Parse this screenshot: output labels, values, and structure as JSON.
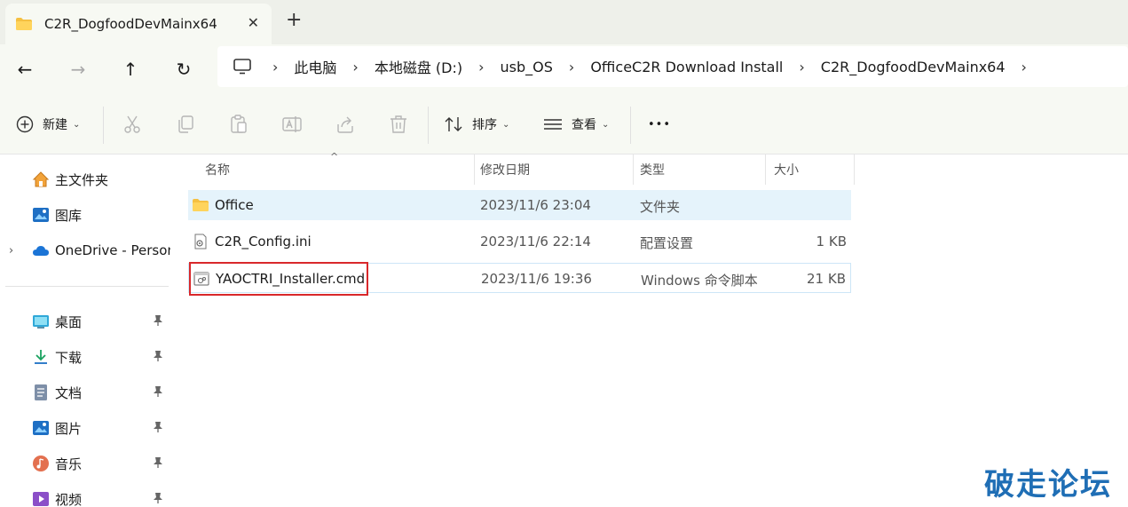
{
  "tab": {
    "title": "C2R_DogfoodDevMainx64",
    "close": "✕",
    "add": "+"
  },
  "nav": {
    "back": "←",
    "forward": "→",
    "up": "↑",
    "refresh": "↻"
  },
  "breadcrumb": [
    "此电脑",
    "本地磁盘 (D:)",
    "usb_OS",
    "OfficeC2R Download Install",
    "C2R_DogfoodDevMainx64"
  ],
  "breadcrumb_sep": "›",
  "toolbar": {
    "new_label": "新建",
    "sort_label": "排序",
    "view_label": "查看",
    "more_label": "•••",
    "caret": "⌄"
  },
  "sidebar": {
    "items": [
      {
        "label": "主文件夹",
        "icon": "home-icon"
      },
      {
        "label": "图库",
        "icon": "gallery-icon"
      },
      {
        "label": "OneDrive - Personal",
        "icon": "cloud-icon",
        "expand": "›"
      },
      {
        "label": "桌面",
        "icon": "desktop-icon",
        "pin": "📌"
      },
      {
        "label": "下载",
        "icon": "download-icon",
        "pin": "📌"
      },
      {
        "label": "文档",
        "icon": "document-icon",
        "pin": "📌"
      },
      {
        "label": "图片",
        "icon": "picture-icon",
        "pin": "📌"
      },
      {
        "label": "音乐",
        "icon": "music-icon",
        "pin": "📌"
      },
      {
        "label": "视频",
        "icon": "video-icon",
        "pin": "📌"
      }
    ]
  },
  "columns": {
    "name": "名称",
    "modified": "修改日期",
    "type": "类型",
    "size": "大小",
    "sort_arrow": "^"
  },
  "files": [
    {
      "name": "Office",
      "modified": "2023/11/6 23:04",
      "type": "文件夹",
      "size": ""
    },
    {
      "name": "C2R_Config.ini",
      "modified": "2023/11/6 22:14",
      "type": "配置设置",
      "size": "1 KB"
    },
    {
      "name": "YAOCTRI_Installer.cmd",
      "modified": "2023/11/6 19:36",
      "type": "Windows 命令脚本",
      "size": "21 KB"
    }
  ],
  "watermark": "破走论坛",
  "colors": {
    "accent": "#1f6eb5",
    "folder": "#f5c042",
    "selection": "#e5f3fb",
    "highlight_box": "#d9282b"
  }
}
